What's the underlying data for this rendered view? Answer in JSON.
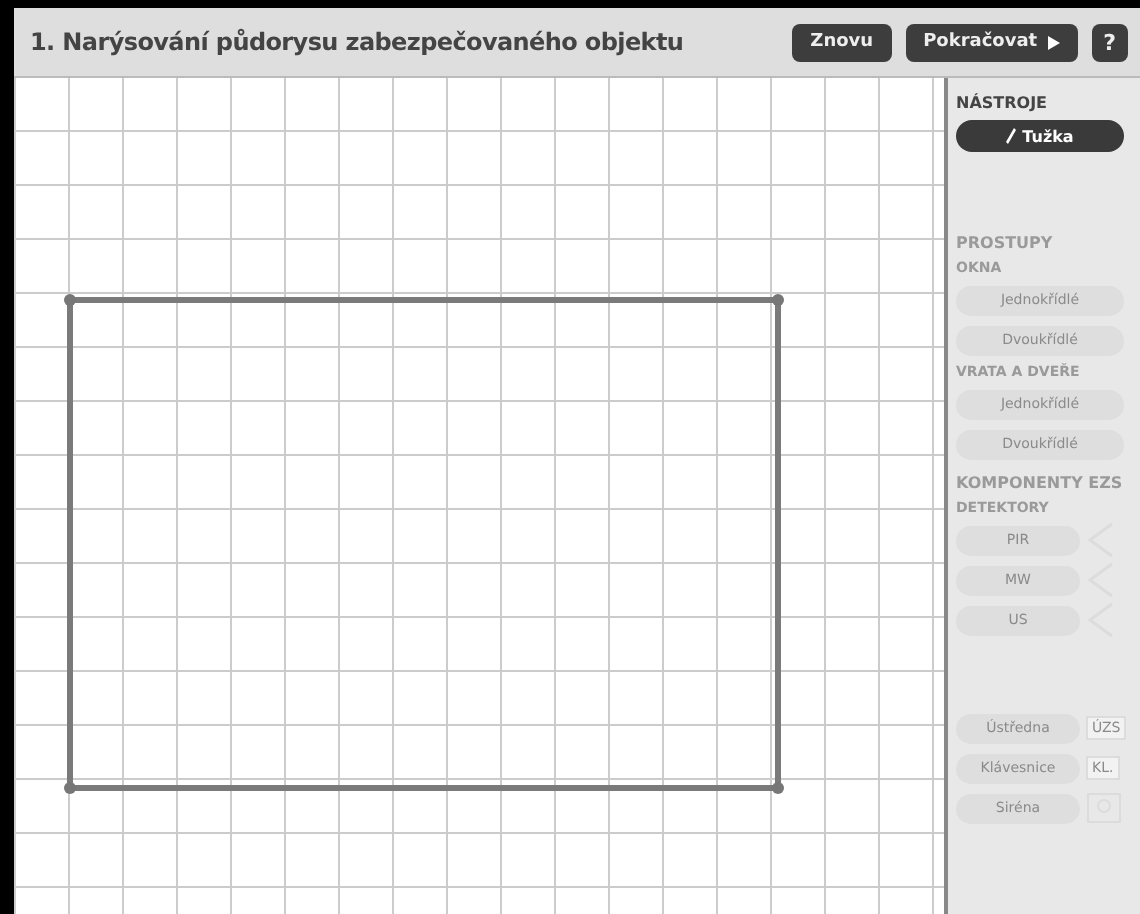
{
  "title": "1. Narýsování půdorysu zabezpečovaného objektu",
  "buttons": [
    {
      "label": "Znovu",
      "kind": "plain"
    },
    {
      "label": "Pokračovat",
      "kind": "next"
    },
    {
      "label": "?",
      "kind": "help"
    }
  ],
  "sidebar": [
    {
      "kind": "heading",
      "label": "NÁSTROJE",
      "disabled": false
    },
    {
      "kind": "tool",
      "label": "Tužka",
      "selected": true,
      "disabled": false
    },
    {
      "kind": "gap"
    },
    {
      "kind": "heading",
      "label": "PROSTUPY",
      "disabled": true
    },
    {
      "kind": "subheading",
      "label": "OKNA",
      "disabled": true
    },
    {
      "kind": "button",
      "label": "Jednokřídlé",
      "disabled": true
    },
    {
      "kind": "button",
      "label": "Dvoukřídlé",
      "disabled": true
    },
    {
      "kind": "subheading",
      "label": "VRATA A DVEŘE",
      "disabled": true
    },
    {
      "kind": "button",
      "label": "Jednokřídlé",
      "disabled": true
    },
    {
      "kind": "button",
      "label": "Dvoukřídlé",
      "disabled": true
    },
    {
      "kind": "heading",
      "label": "KOMPONENTY EZS",
      "disabled": true
    },
    {
      "kind": "subheading",
      "label": "DETEKTORY",
      "disabled": true
    },
    {
      "kind": "detector",
      "label": "PIR",
      "disabled": true
    },
    {
      "kind": "detector",
      "label": "MW",
      "disabled": true
    },
    {
      "kind": "detector",
      "label": "US",
      "disabled": true
    },
    {
      "kind": "gap"
    },
    {
      "kind": "badged",
      "label": "Ústředna",
      "badge": "ÚZS",
      "disabled": true
    },
    {
      "kind": "badged",
      "label": "Klávesnice",
      "badge": "KL.",
      "disabled": true
    },
    {
      "kind": "siren",
      "label": "Siréna",
      "disabled": true
    }
  ]
}
